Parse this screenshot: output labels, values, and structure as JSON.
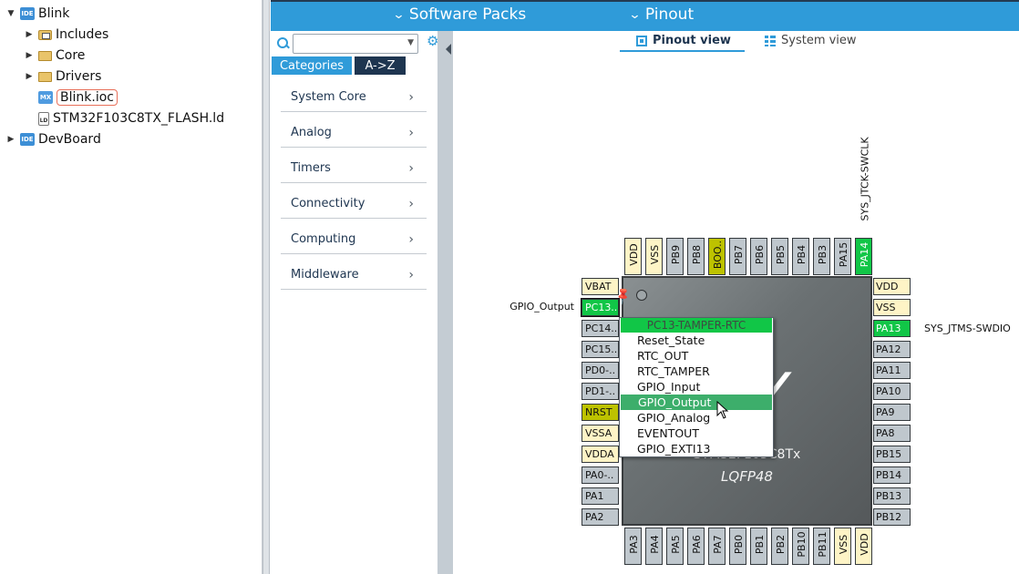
{
  "explorer": {
    "items": [
      {
        "label": "Blink",
        "level": 0,
        "expanded": true,
        "icon": "ide-project-icon"
      },
      {
        "label": "Includes",
        "level": 1,
        "expanded": false,
        "icon": "includes-folder-icon"
      },
      {
        "label": "Core",
        "level": 1,
        "expanded": false,
        "icon": "folder-icon"
      },
      {
        "label": "Drivers",
        "level": 1,
        "expanded": false,
        "icon": "folder-icon"
      },
      {
        "label": "Blink.ioc",
        "level": 1,
        "icon": "mx-file-icon",
        "selected": true
      },
      {
        "label": "STM32F103C8TX_FLASH.ld",
        "level": 1,
        "icon": "ld-file-icon"
      },
      {
        "label": "DevBoard",
        "level": 0,
        "expanded": false,
        "icon": "ide-project-icon"
      }
    ]
  },
  "topbar": {
    "software_packs": "Software Packs",
    "pinout": "Pinout"
  },
  "categories": {
    "search_value": "",
    "tab_categories": "Categories",
    "tab_az": "A->Z",
    "items": [
      "System Core",
      "Analog",
      "Timers",
      "Connectivity",
      "Computing",
      "Middleware"
    ]
  },
  "views": {
    "pinout_view": "Pinout view",
    "system_view": "System view"
  },
  "chip": {
    "part": "STM32F103C8Tx",
    "package": "LQFP48"
  },
  "pins": {
    "left": [
      {
        "name": "VBAT",
        "color": "yellow"
      },
      {
        "name": "PC13..",
        "color": "green",
        "label": "GPIO_Output"
      },
      {
        "name": "PC14..",
        "color": "gray"
      },
      {
        "name": "PC15..",
        "color": "gray"
      },
      {
        "name": "PD0-..",
        "color": "gray"
      },
      {
        "name": "PD1-..",
        "color": "gray"
      },
      {
        "name": "NRST",
        "color": "olive"
      },
      {
        "name": "VSSA",
        "color": "yellow"
      },
      {
        "name": "VDDA",
        "color": "yellow"
      },
      {
        "name": "PA0-..",
        "color": "gray"
      },
      {
        "name": "PA1",
        "color": "gray"
      },
      {
        "name": "PA2",
        "color": "gray"
      }
    ],
    "right": [
      {
        "name": "VDD",
        "color": "yellow"
      },
      {
        "name": "VSS",
        "color": "yellow"
      },
      {
        "name": "PA13",
        "color": "green",
        "label": "SYS_JTMS-SWDIO"
      },
      {
        "name": "PA12",
        "color": "gray"
      },
      {
        "name": "PA11",
        "color": "gray"
      },
      {
        "name": "PA10",
        "color": "gray"
      },
      {
        "name": "PA9",
        "color": "gray"
      },
      {
        "name": "PA8",
        "color": "gray"
      },
      {
        "name": "PB15",
        "color": "gray"
      },
      {
        "name": "PB14",
        "color": "gray"
      },
      {
        "name": "PB13",
        "color": "gray"
      },
      {
        "name": "PB12",
        "color": "gray"
      }
    ],
    "top": [
      {
        "name": "VDD",
        "color": "yellow"
      },
      {
        "name": "VSS",
        "color": "yellow"
      },
      {
        "name": "PB9",
        "color": "gray"
      },
      {
        "name": "PB8",
        "color": "gray"
      },
      {
        "name": "BOO..",
        "color": "olive"
      },
      {
        "name": "PB7",
        "color": "gray"
      },
      {
        "name": "PB6",
        "color": "gray"
      },
      {
        "name": "PB5",
        "color": "gray"
      },
      {
        "name": "PB4",
        "color": "gray"
      },
      {
        "name": "PB3",
        "color": "gray"
      },
      {
        "name": "PA15",
        "color": "gray"
      },
      {
        "name": "PA14",
        "color": "green",
        "label": "SYS_JTCK-SWCLK"
      }
    ],
    "bottom": [
      {
        "name": "PA3",
        "color": "gray"
      },
      {
        "name": "PA4",
        "color": "gray"
      },
      {
        "name": "PA5",
        "color": "gray"
      },
      {
        "name": "PA6",
        "color": "gray"
      },
      {
        "name": "PA7",
        "color": "gray"
      },
      {
        "name": "PB0",
        "color": "gray"
      },
      {
        "name": "PB1",
        "color": "gray"
      },
      {
        "name": "PB2",
        "color": "gray"
      },
      {
        "name": "PB10",
        "color": "gray"
      },
      {
        "name": "PB11",
        "color": "gray"
      },
      {
        "name": "VSS",
        "color": "yellow"
      },
      {
        "name": "VDD",
        "color": "yellow"
      }
    ]
  },
  "context_menu": {
    "title": "PC13-TAMPER-RTC",
    "items": [
      "Reset_State",
      "RTC_OUT",
      "RTC_TAMPER",
      "GPIO_Input",
      "GPIO_Output",
      "GPIO_Analog",
      "EVENTOUT",
      "GPIO_EXTI13"
    ],
    "highlighted": "GPIO_Output"
  },
  "colors": {
    "accent": "#2f9bd9",
    "dark_tab": "#1e3550",
    "pin_green": "#11c647",
    "pin_gray": "#bfc7cd",
    "pin_yellow": "#fef4c6",
    "pin_olive": "#bdc200",
    "menu_highlight": "#3dae6b"
  }
}
